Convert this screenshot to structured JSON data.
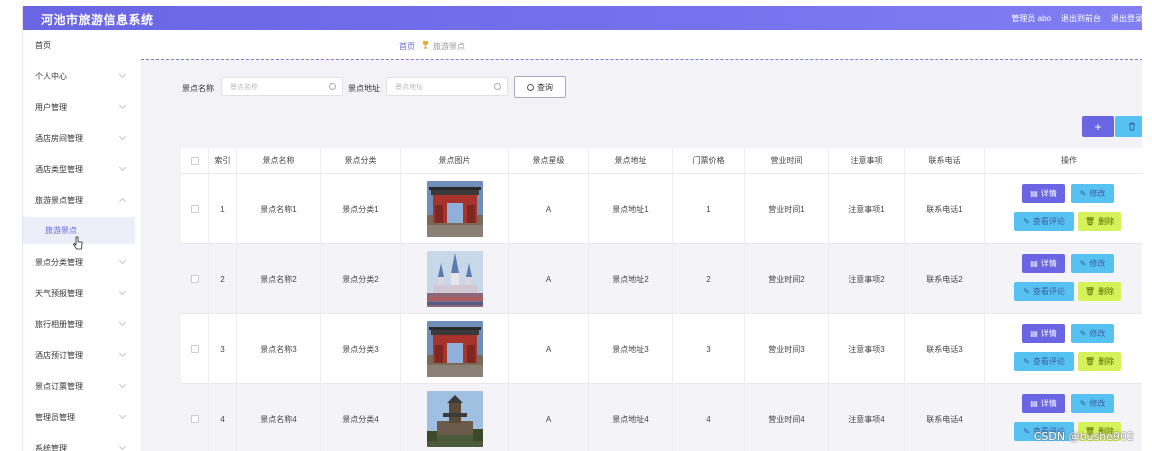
{
  "app_title": "河池市旅游信息系统",
  "header": {
    "admin_label": "管理员 abo",
    "back_label": "退出到前台",
    "logout_label": "退出登录"
  },
  "sidebar": {
    "items": [
      "首页",
      "个人中心",
      "用户管理",
      "酒店房间管理",
      "酒店类型管理",
      "旅游景点管理",
      "景点分类管理",
      "天气预报管理",
      "旅行相册管理",
      "酒店预订管理",
      "景点订票管理",
      "管理员管理",
      "系统管理"
    ],
    "sub_item": "旅游景点"
  },
  "breadcrumb": {
    "home": "首页",
    "current": "旅游景点"
  },
  "search": {
    "name_label": "景点名称",
    "name_placeholder": "景点名称",
    "addr_label": "景点地址",
    "addr_placeholder": "景点地址",
    "button": "查询"
  },
  "toolbar": {
    "add": "+"
  },
  "table": {
    "headers": [
      "索引",
      "景点名称",
      "景点分类",
      "景点图片",
      "景点星级",
      "景点地址",
      "门票价格",
      "营业时间",
      "注意事项",
      "联系电话",
      "操作"
    ],
    "rows": [
      [
        "1",
        "景点名称1",
        "景点分类1",
        "A",
        "景点地址1",
        "1",
        "营业时间1",
        "注意事项1",
        "联系电话1"
      ],
      [
        "2",
        "景点名称2",
        "景点分类2",
        "A",
        "景点地址2",
        "2",
        "营业时间2",
        "注意事项2",
        "联系电话2"
      ],
      [
        "3",
        "景点名称3",
        "景点分类3",
        "A",
        "景点地址3",
        "3",
        "营业时间3",
        "注意事项3",
        "联系电话3"
      ],
      [
        "4",
        "景点名称4",
        "景点分类4",
        "A",
        "景点地址4",
        "4",
        "营业时间4",
        "注意事项4",
        "联系电话4"
      ]
    ],
    "actions": {
      "detail": "详情",
      "edit": "修改",
      "review": "查看评论",
      "delete": "删除"
    }
  },
  "watermark": "CSDN @bushe902",
  "colors": {
    "primary": "#6a66e3",
    "info": "#55c2f2",
    "danger": "#d7f15a"
  }
}
